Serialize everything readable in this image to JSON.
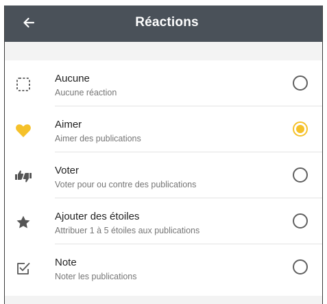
{
  "appbar": {
    "title": "Réactions",
    "back_icon": "arrow-left-icon",
    "background": "#4a5159"
  },
  "accent_color": "#f5c12a",
  "options": [
    {
      "label": "Aucune",
      "sublabel": "Aucune réaction",
      "icon": "dashed-square-icon",
      "selected": false
    },
    {
      "label": "Aimer",
      "sublabel": "Aimer des publications",
      "icon": "heart-icon",
      "selected": true
    },
    {
      "label": "Voter",
      "sublabel": "Voter pour ou contre des publications",
      "icon": "thumbs-up-down-icon",
      "selected": false
    },
    {
      "label": "Ajouter des étoiles",
      "sublabel": "Attribuer 1 à 5 étoiles aux publications",
      "icon": "star-icon",
      "selected": false
    },
    {
      "label": "Note",
      "sublabel": "Noter les publications",
      "icon": "checkbox-icon",
      "selected": false
    }
  ]
}
